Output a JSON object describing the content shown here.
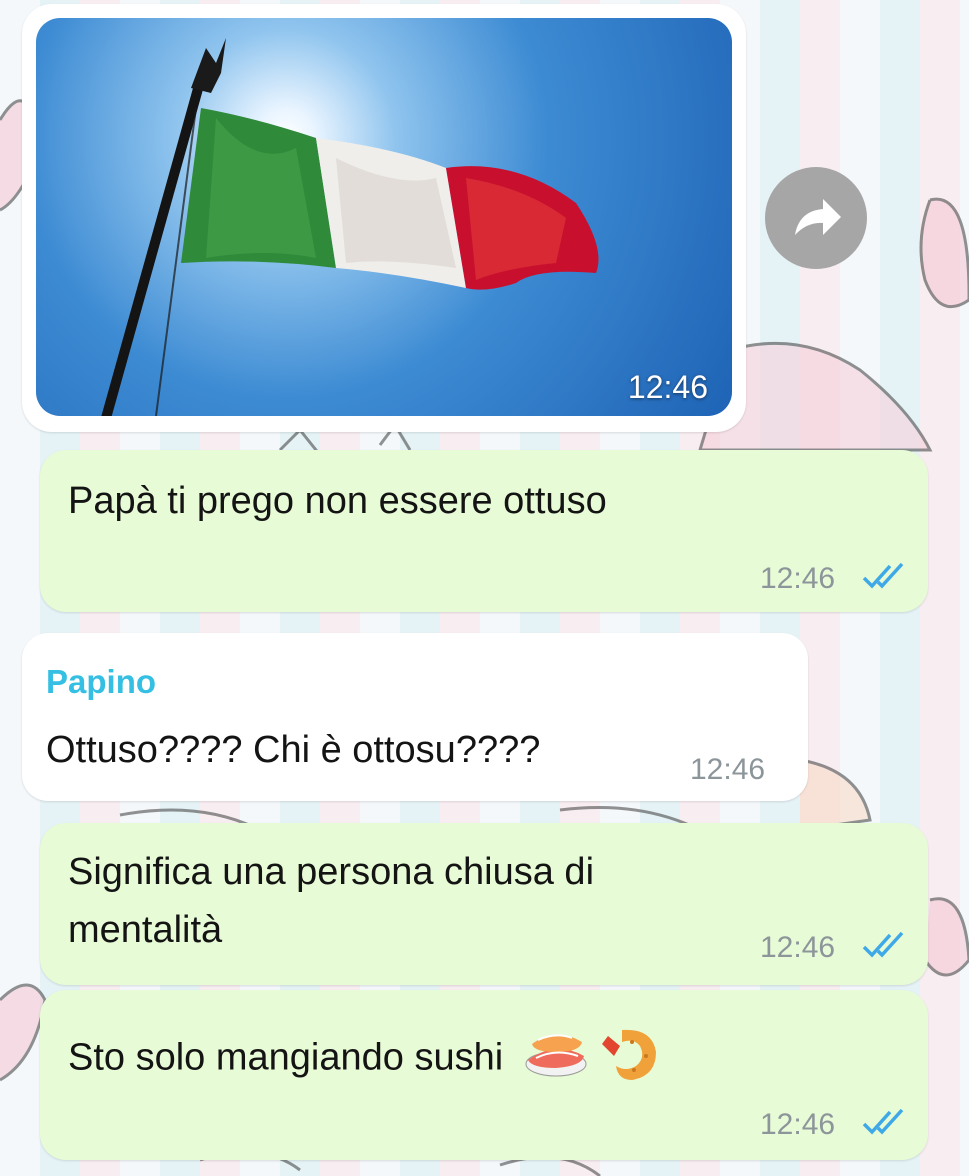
{
  "chat": {
    "photo_message": {
      "time": "12:46"
    },
    "messages": [
      {
        "direction": "out",
        "text": "Papà ti prego non essere ottuso",
        "time": "12:46",
        "status": "read"
      },
      {
        "direction": "in",
        "sender": "Papino",
        "text": "Ottuso???? Chi è ottosu????",
        "time": "12:46"
      },
      {
        "direction": "out",
        "text_line1": "Significa una persona chiusa di",
        "text_line2": "mentalità",
        "time": "12:46",
        "status": "read"
      },
      {
        "direction": "out",
        "text": "Sto solo mangiando sushi",
        "emoji": "🍣🍤",
        "time": "12:46",
        "status": "read"
      }
    ]
  },
  "icons": {
    "forward": "forward-arrow-icon",
    "ticks": "double-check-read-icon",
    "sushi": "sushi-emoji",
    "shrimp": "fried-shrimp-emoji"
  },
  "colors": {
    "outgoing_bubble": "#e7fbd6",
    "incoming_bubble": "#ffffff",
    "sender_name": "#35bfe3",
    "read_ticks": "#3fa9e8",
    "timestamp": "#8c959a"
  }
}
